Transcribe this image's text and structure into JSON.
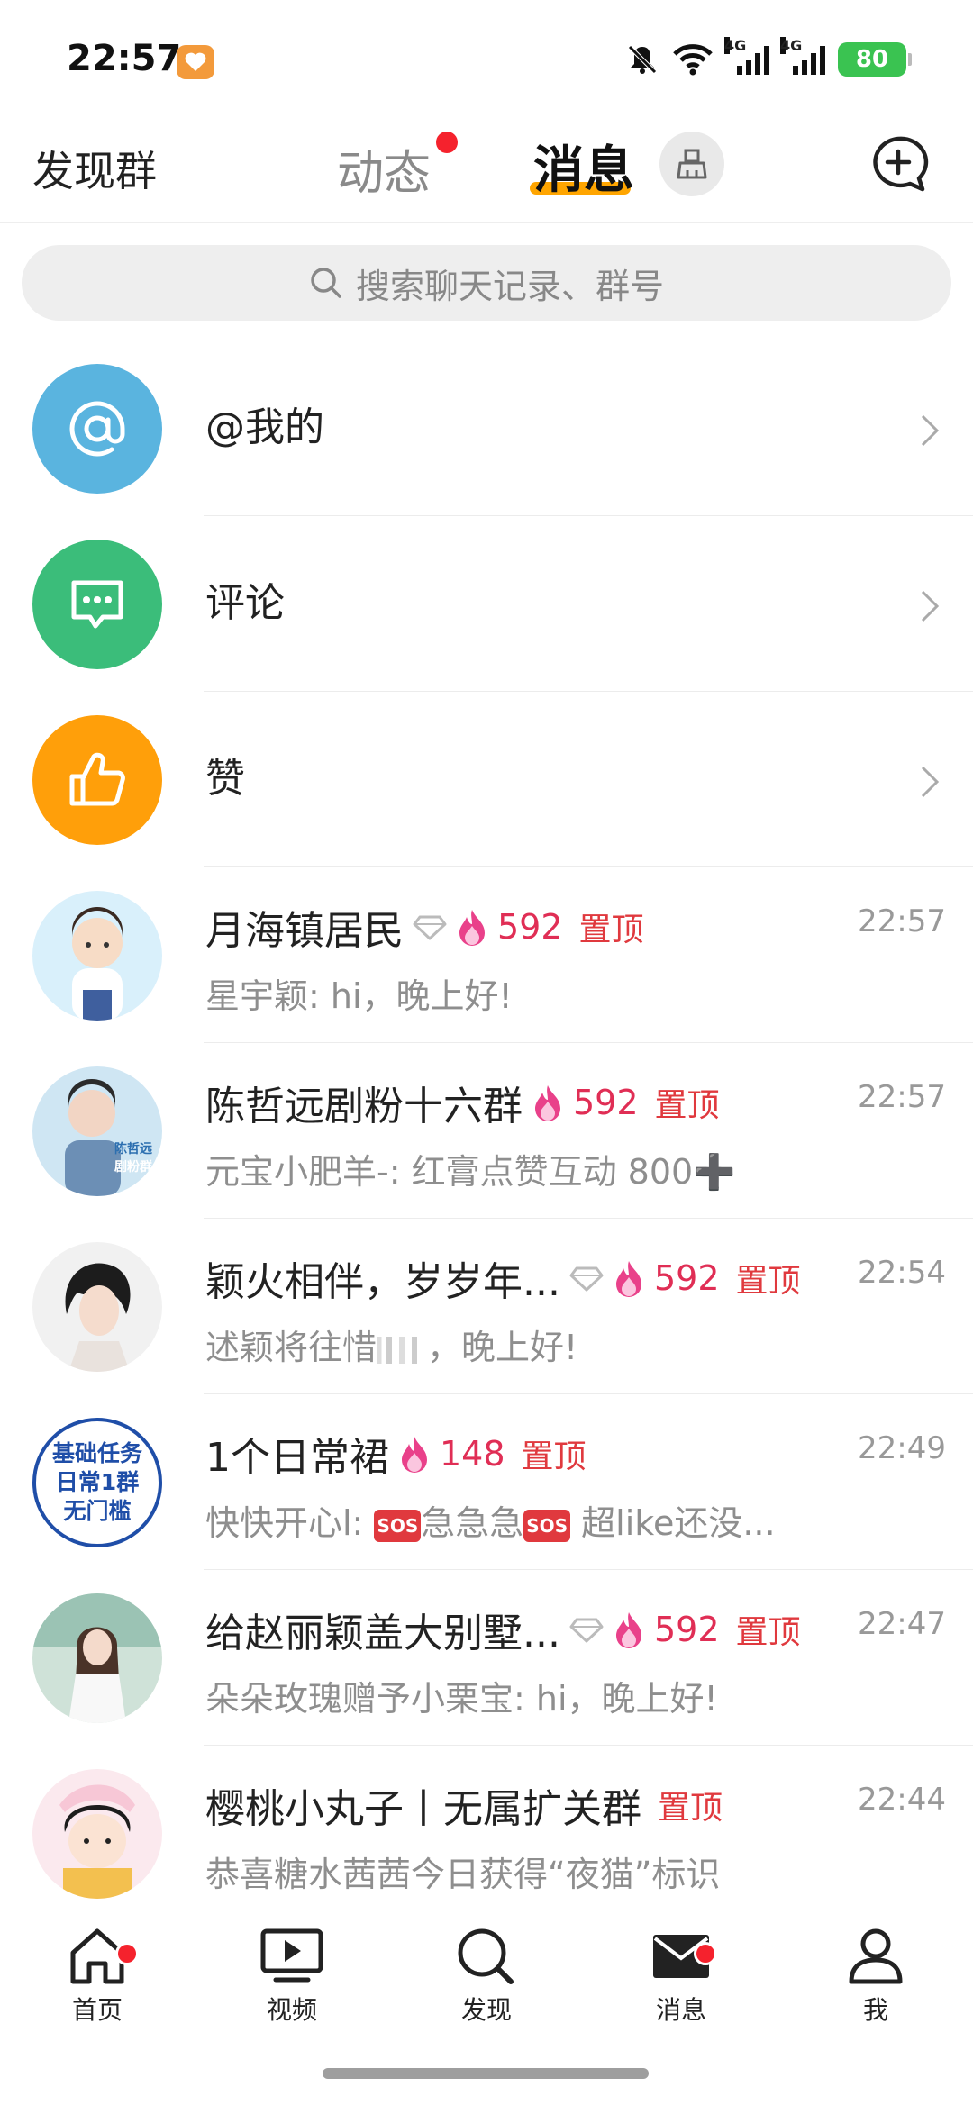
{
  "status_bar": {
    "time": "22:57",
    "signal_1_tag": "4G",
    "signal_2_tag": "4G",
    "battery": "80"
  },
  "header": {
    "left_label": "发现群",
    "tab_dongtai": "动态",
    "tab_xiaoxi": "消息"
  },
  "search": {
    "placeholder": "搜索聊天记录、群号"
  },
  "shortcuts": [
    {
      "label": "@我的",
      "color": "#5ab4df",
      "icon": "at-icon"
    },
    {
      "label": "评论",
      "color": "#3bbd7a",
      "icon": "comment-icon"
    },
    {
      "label": "赞",
      "color": "#ff9f0a",
      "icon": "thumbs-up-icon"
    }
  ],
  "chats": [
    {
      "name": "月海镇居民",
      "hot": "592",
      "pin": "置顶",
      "time": "22:57",
      "preview": "星宇颖: hi，晚上好!"
    },
    {
      "name": "陈哲远剧粉十六群",
      "hot": "592",
      "pin": "置顶",
      "time": "22:57",
      "preview": "元宝小肥羊-: 红膏点赞互动 800➕",
      "avatar_text_1": "陈哲远",
      "avatar_text_2": "剧粉群"
    },
    {
      "name": "颖火相伴，岁岁年...",
      "hot": "592",
      "pin": "置顶",
      "time": "22:54",
      "preview": "述颖将往惜",
      "preview_end": "，晚上好!"
    },
    {
      "name": "1个日常裙",
      "hot": "148",
      "pin": "置顶",
      "time": "22:49",
      "preview_a": "快快开心l: ",
      "preview_b": "急急急",
      "preview_c": " 超like还没...",
      "sos": "SOS",
      "avatar_lines": [
        "基础任务",
        "日常1群",
        "无门槛"
      ]
    },
    {
      "name": "给赵丽颖盖大别墅...",
      "hot": "592",
      "pin": "置顶",
      "time": "22:47",
      "preview": "朵朵玫瑰赠予小栗宝: hi，晚上好!"
    },
    {
      "name": "樱桃小丸子丨无属扩关群",
      "pin": "置顶",
      "time": "22:44",
      "preview": "恭喜糖水茜茜今日获得“夜猫”标识"
    }
  ],
  "nav": [
    {
      "label": "首页",
      "icon": "home-icon",
      "badge": true
    },
    {
      "label": "视频",
      "icon": "video-icon",
      "badge": false
    },
    {
      "label": "发现",
      "icon": "discover-search-icon",
      "badge": false
    },
    {
      "label": "消息",
      "icon": "message-mail-icon",
      "badge": true
    },
    {
      "label": "我",
      "icon": "profile-icon",
      "badge": false
    }
  ],
  "colors": {
    "accent": "#ffa500",
    "badge": "#f5222d",
    "hot": "#e02e55",
    "pin": "#e0393e"
  }
}
